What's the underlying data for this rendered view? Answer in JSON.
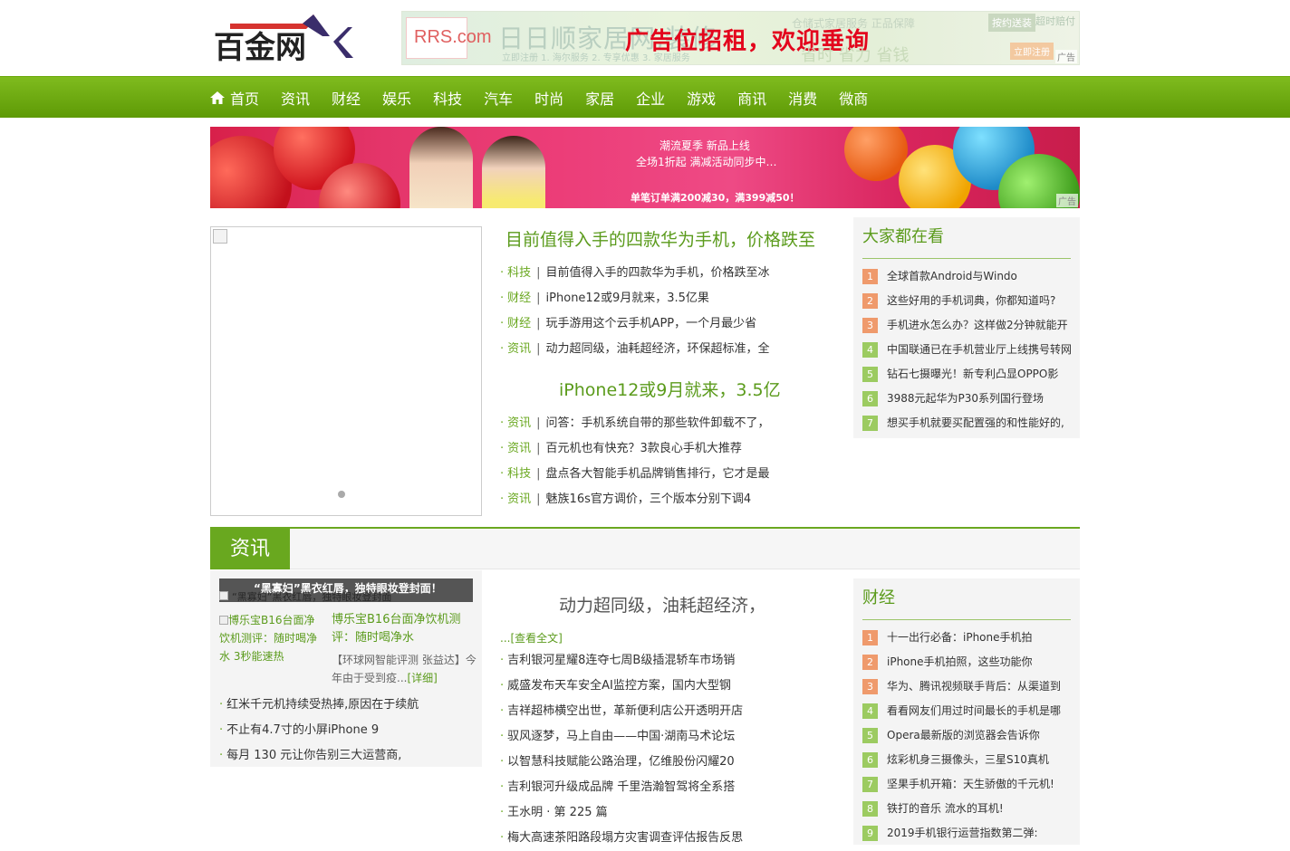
{
  "header": {
    "logo_text": "百金网",
    "ad": {
      "brand": "RRS.com",
      "faint_text": "日日顺家居网,装修",
      "faint_sub": "立即注册 1. 海尔服务 2. 专享优惠 3. 家居服务",
      "title": "广告位招租，欢迎垂询",
      "right_text": "仓储式家居服务 正品保障",
      "right_text2": "省时 省力 省钱",
      "badge1": "按约送装",
      "badge2": "超时赔付",
      "badge3": "立即注册",
      "tag": "广告"
    }
  },
  "nav": {
    "items": [
      "首页",
      "资讯",
      "财经",
      "娱乐",
      "科技",
      "汽车",
      "时尚",
      "家居",
      "企业",
      "游戏",
      "商讯",
      "消费",
      "微商"
    ]
  },
  "banner": {
    "line1": "潮流夏季  新品上线",
    "line2": "全场1折起  满减活动同步中…",
    "line3": "单笔订单满200减30，满399减50！",
    "tag": "广告"
  },
  "top": {
    "headline1": "目前值得入手的四款华为手机，价格跌至",
    "list1": [
      {
        "cat": "科技",
        "title": "目前值得入手的四款华为手机，价格跌至冰"
      },
      {
        "cat": "财经",
        "title": "iPhone12或9月就来，3.5亿果"
      },
      {
        "cat": "财经",
        "title": "玩手游用这个云手机APP，一个月最少省"
      },
      {
        "cat": "资讯",
        "title": "动力超同级，油耗超经济，环保超标准，全"
      }
    ],
    "headline2": "iPhone12或9月就来，3.5亿",
    "list2": [
      {
        "cat": "资讯",
        "title": "问答：手机系统自带的那些软件卸载不了，"
      },
      {
        "cat": "资讯",
        "title": "百元机也有快充？3款良心手机大推荐"
      },
      {
        "cat": "科技",
        "title": "盘点各大智能手机品牌销售排行，它才是最"
      },
      {
        "cat": "资讯",
        "title": "魅族16s官方调价，三个版本分别下调4"
      }
    ]
  },
  "popular": {
    "title": "大家都在看",
    "items": [
      "全球首款Android与Windo",
      "这些好用的手机词典，你都知道吗?",
      "手机进水怎么办？这样做2分钟就能开",
      "中国联通已在手机营业厅上线携号转网",
      "钻石七摄曝光！新专利凸显OPPO影",
      "3988元起华为P30系列国行登场",
      "想买手机就要买配置强的和性能好的,"
    ]
  },
  "news_section": {
    "tab": "资讯",
    "focus_caption": "“黑寡妇”黑衣红唇，独特眼妆登封面！",
    "focus_alt": "“黑寡妇”黑衣红唇，独特眼妆登封面",
    "mini_alt": "博乐宝B16台面净饮机测评：随时喝净水 3秒能速热",
    "mini_title": "博乐宝B16台面净饮机测评：随时喝净水",
    "mini_desc": "【环球网智能评测 张益达】今年由于受到疫...",
    "mini_detail": "[详细]",
    "side_list": [
      "红米千元机持续受热捧,原因在于续航",
      "不止有4.7寸的小屏iPhone 9",
      "每月 130 元让你告别三大运营商,"
    ],
    "mid_headline": "动力超同级，油耗超经济，",
    "read_all": "...[查看全文]",
    "mid_list": [
      "吉利银河星耀8连夺七周B级插混轿车市场销",
      "威盛发布天车安全AI监控方案，国内大型钢",
      "吉祥超柿横空出世，革新便利店公开透明开店",
      "驭风逐梦，马上自由——中国·湖南马术论坛",
      "以智慧科技赋能公路治理，亿维股份闪耀20",
      "吉利银河升级成品牌 千里浩瀚智驾将全系搭",
      "王水明 · 第 225 篇",
      "梅大高速茶阳路段塌方灾害调查评估报告反思"
    ]
  },
  "finance": {
    "title": "财经",
    "items": [
      "十一出行必备：iPhone手机拍",
      "iPhone手机拍照，这些功能你",
      "华为、腾讯视频联手背后：从渠道到",
      "看看网友们用过时间最长的手机是哪",
      "Opera最新版的浏览器会告诉你",
      "炫彩机身三摄像头，三星S10真机",
      "坚果手机开箱：天生骄傲的千元机!",
      "铁打的音乐 流水的耳机!",
      "2019手机银行运营指数第二弹:"
    ]
  },
  "colors": {
    "accent_green": "#69a81f",
    "rank_hot": "#ef9a6c",
    "rank_cold": "#9ccb61",
    "ad_red": "#e3051d"
  }
}
